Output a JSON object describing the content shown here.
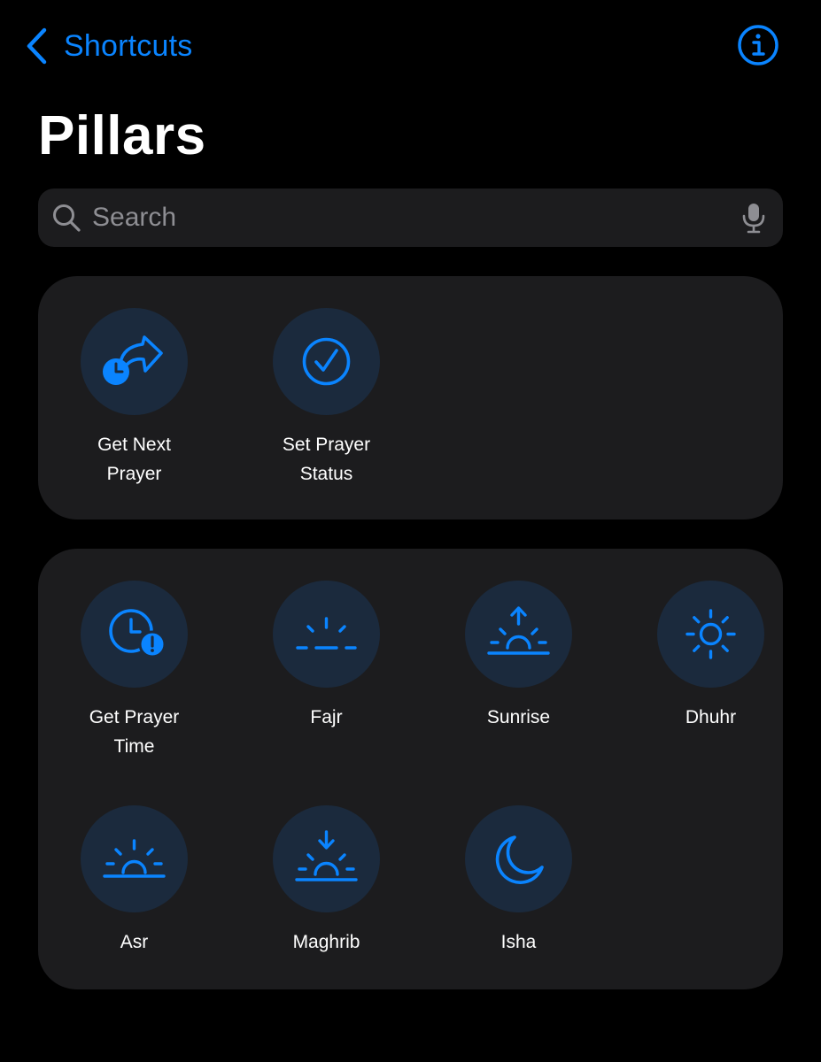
{
  "nav": {
    "back_label": "Shortcuts",
    "back_icon": "chevron-left-icon",
    "info_icon": "info-circle-icon"
  },
  "page": {
    "title": "Pillars"
  },
  "search": {
    "placeholder": "Search",
    "value": ""
  },
  "colors": {
    "accent": "#0a84ff",
    "background": "#000000",
    "card": "#1c1c1e",
    "tile_circle": "#1b2a3d",
    "placeholder": "#8e8e93"
  },
  "sections": [
    {
      "tiles": [
        {
          "label_lines": [
            "Get Next",
            "Prayer"
          ],
          "icon": "clock-share-arrow-icon"
        },
        {
          "label_lines": [
            "Set Prayer",
            "Status"
          ],
          "icon": "checkmark-circle-icon"
        }
      ]
    },
    {
      "tiles": [
        {
          "label_lines": [
            "Get Prayer",
            "Time"
          ],
          "icon": "clock-exclamation-icon"
        },
        {
          "label_lines": [
            "Fajr"
          ],
          "icon": "horizon-icon"
        },
        {
          "label_lines": [
            "Sunrise"
          ],
          "icon": "sunrise-icon"
        },
        {
          "label_lines": [
            "Dhuhr"
          ],
          "icon": "sun-icon"
        },
        {
          "label_lines": [
            "Asr"
          ],
          "icon": "sun-horizon-icon"
        },
        {
          "label_lines": [
            "Maghrib"
          ],
          "icon": "sunset-icon"
        },
        {
          "label_lines": [
            "Isha"
          ],
          "icon": "moon-icon"
        }
      ]
    }
  ]
}
